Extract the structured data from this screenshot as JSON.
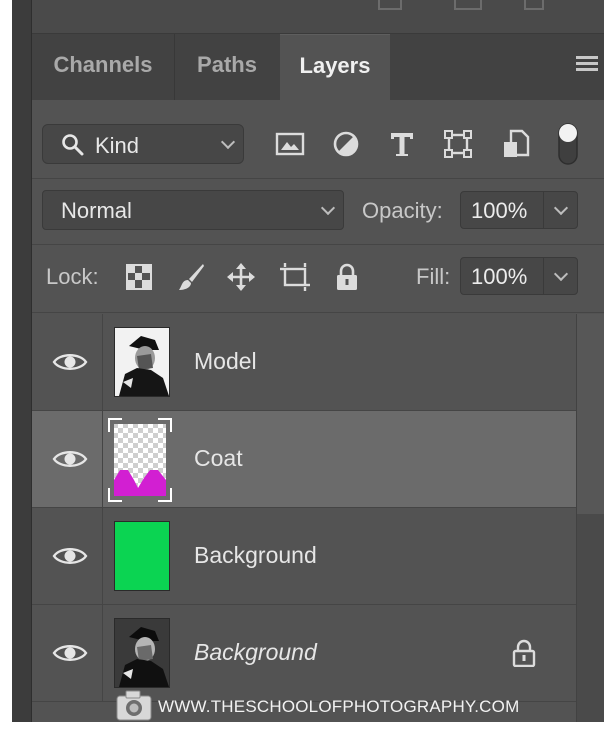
{
  "tabs": [
    {
      "label": "Channels",
      "active": false
    },
    {
      "label": "Paths",
      "active": false
    },
    {
      "label": "Layers",
      "active": true
    }
  ],
  "filter": {
    "kind_label": "Kind",
    "icons": [
      "image-filter-icon",
      "adjustment-filter-icon",
      "type-filter-icon",
      "shape-filter-icon",
      "smart-object-filter-icon",
      "filter-toggle-switch"
    ]
  },
  "blend": {
    "mode": "Normal",
    "opacity_label": "Opacity:",
    "opacity_value": "100%"
  },
  "lock": {
    "label": "Lock:",
    "icons": [
      "lock-transparent-pixels-icon",
      "lock-image-pixels-icon",
      "lock-position-icon",
      "lock-artboard-icon",
      "lock-all-icon"
    ],
    "fill_label": "Fill:",
    "fill_value": "100%"
  },
  "layers": [
    {
      "name": "Model",
      "thumb": "photo",
      "selected": false,
      "italic": false,
      "locked": false
    },
    {
      "name": "Coat",
      "thumb": "mask",
      "selected": true,
      "italic": false,
      "locked": false
    },
    {
      "name": "Background",
      "thumb": "solid-green",
      "selected": false,
      "italic": false,
      "locked": false
    },
    {
      "name": "Background",
      "thumb": "photo",
      "selected": false,
      "italic": true,
      "locked": true
    }
  ],
  "colors": {
    "fill_green": "#0bd452",
    "coat_magenta": "#d21fd2",
    "panel_bg": "#535353",
    "selected_row": "#6b6b6b"
  },
  "watermark": "WWW.THESCHOOLOFPHOTOGRAPHY.COM"
}
